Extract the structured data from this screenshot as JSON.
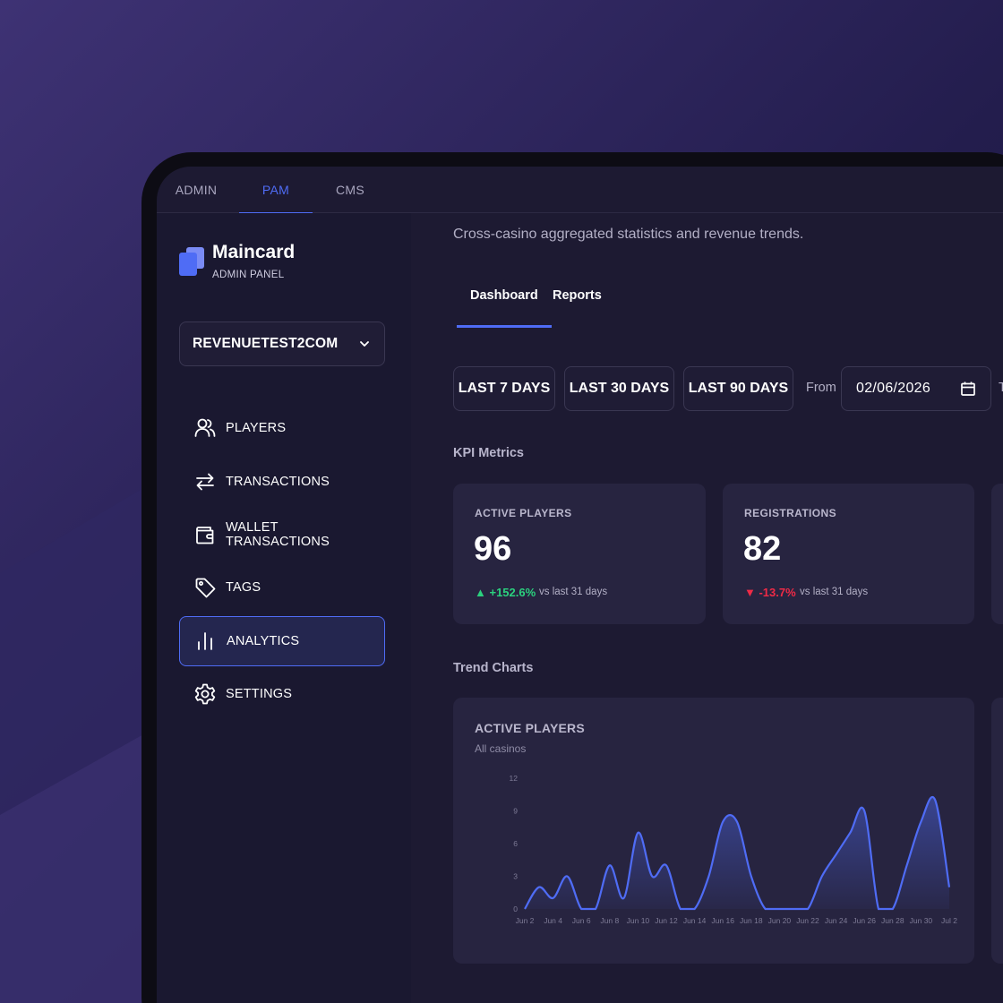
{
  "top_tabs": [
    "ADMIN",
    "PAM",
    "CMS"
  ],
  "active_top_tab": "PAM",
  "brand": {
    "name": "Maincard",
    "subtitle": "ADMIN PANEL"
  },
  "casino_select": {
    "value": "REVENUETEST2COM"
  },
  "nav": [
    {
      "label": "PLAYERS",
      "icon": "users-icon"
    },
    {
      "label": "TRANSACTIONS",
      "icon": "arrows-swap-icon"
    },
    {
      "label": "WALLET TRANSACTIONS",
      "icon": "wallet-icon"
    },
    {
      "label": "TAGS",
      "icon": "tag-icon"
    },
    {
      "label": "ANALYTICS",
      "icon": "bar-chart-icon",
      "active": true
    },
    {
      "label": "SETTINGS",
      "icon": "gear-icon"
    }
  ],
  "page": {
    "subtitle": "Cross-casino aggregated statistics and revenue trends.",
    "tabs": [
      "Dashboard",
      "Reports"
    ],
    "active_tab": "Dashboard"
  },
  "range_buttons": [
    "LAST 7 DAYS",
    "LAST 30 DAYS",
    "LAST 90 DAYS"
  ],
  "from_label": "From",
  "from_date": "02/06/2026",
  "to_label_stub": "T",
  "kpi_section": "KPI Metrics",
  "kpis": [
    {
      "label": "ACTIVE PLAYERS",
      "value": "96",
      "delta": "▲ +152.6%",
      "direction": "up",
      "vs": "vs last 31 days"
    },
    {
      "label": "REGISTRATIONS",
      "value": "82",
      "delta": "▼ -13.7%",
      "direction": "down",
      "vs": "vs last 31 days"
    }
  ],
  "trend_section": "Trend Charts",
  "trend_chart": {
    "title": "ACTIVE PLAYERS",
    "subtitle": "All casinos"
  },
  "colors": {
    "accent": "#4f6cf5",
    "up": "#2bd17e",
    "down": "#ef2a46",
    "card": "#272440"
  },
  "chart_data": {
    "type": "area",
    "title": "ACTIVE PLAYERS",
    "subtitle": "All casinos",
    "ylim": [
      0,
      12
    ],
    "yticks": [
      0,
      3,
      6,
      9,
      12
    ],
    "xtick_labels": [
      "Jun 2",
      "Jun 4",
      "Jun 6",
      "Jun 8",
      "Jun 10",
      "Jun 12",
      "Jun 14",
      "Jun 16",
      "Jun 18",
      "Jun 20",
      "Jun 22",
      "Jun 24",
      "Jun 26",
      "Jun 28",
      "Jun 30",
      "Jul 2"
    ],
    "x": [
      "Jun 2",
      "Jun 3",
      "Jun 4",
      "Jun 5",
      "Jun 6",
      "Jun 7",
      "Jun 8",
      "Jun 9",
      "Jun 10",
      "Jun 11",
      "Jun 12",
      "Jun 13",
      "Jun 14",
      "Jun 15",
      "Jun 16",
      "Jun 17",
      "Jun 18",
      "Jun 19",
      "Jun 20",
      "Jun 21",
      "Jun 22",
      "Jun 23",
      "Jun 24",
      "Jun 25",
      "Jun 26",
      "Jun 27",
      "Jun 28",
      "Jun 29",
      "Jun 30",
      "Jul 1",
      "Jul 2"
    ],
    "series": [
      {
        "values": [
          0,
          2,
          1,
          3,
          0,
          0,
          4,
          1,
          7,
          3,
          4,
          0,
          0,
          3,
          8,
          8,
          3,
          0,
          0,
          0,
          0,
          3,
          5,
          7,
          9,
          0,
          0,
          4,
          8,
          10,
          2
        ]
      }
    ],
    "grid": false,
    "legend": "none"
  }
}
